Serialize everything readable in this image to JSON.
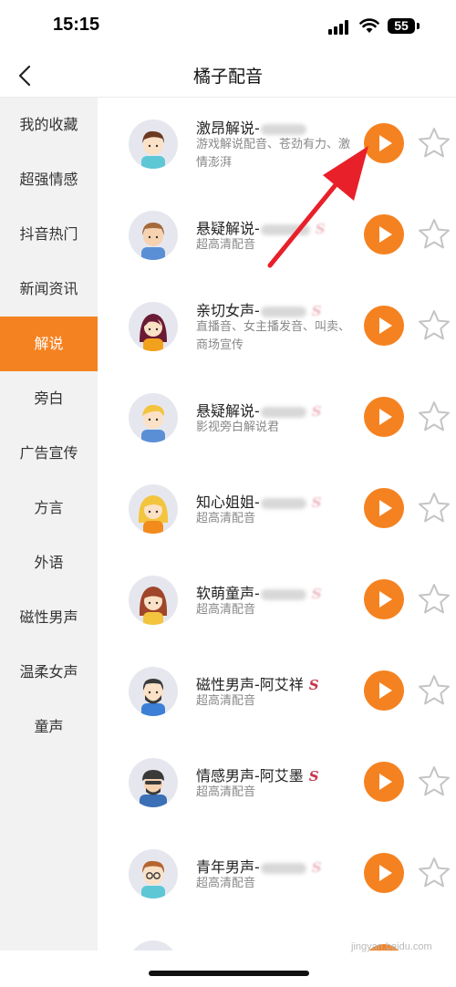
{
  "status_bar": {
    "time": "15:15",
    "battery": "55"
  },
  "nav": {
    "title": "橘子配音"
  },
  "sidebar": {
    "items": [
      {
        "label": "我的收藏"
      },
      {
        "label": "超强情感"
      },
      {
        "label": "抖音热门"
      },
      {
        "label": "新闻资讯"
      },
      {
        "label": "解说",
        "active": true
      },
      {
        "label": "旁白"
      },
      {
        "label": "广告宣传"
      },
      {
        "label": "方言"
      },
      {
        "label": "外语"
      },
      {
        "label": "磁性男声"
      },
      {
        "label": "温柔女声"
      },
      {
        "label": "童声"
      }
    ]
  },
  "voices": [
    {
      "title": "激昂解说-",
      "subtitle": "游戏解说配音、苍劲有力、激情澎湃"
    },
    {
      "title": "悬疑解说-",
      "subtitle": "超高清配音"
    },
    {
      "title": "亲切女声-",
      "subtitle": "直播音、女主播发音、叫卖、商场宣传"
    },
    {
      "title": "悬疑解说-",
      "subtitle": "影视旁白解说君"
    },
    {
      "title": "知心姐姐-",
      "subtitle": "超高清配音"
    },
    {
      "title": "软萌童声-",
      "subtitle": "超高清配音"
    },
    {
      "title": "磁性男声-阿艾祥",
      "subtitle": "超高清配音",
      "badge": "S"
    },
    {
      "title": "情感男声-阿艾墨",
      "subtitle": "超高清配音",
      "badge": "S"
    },
    {
      "title": "青年男声-",
      "subtitle": "超高清配音"
    }
  ],
  "watermark": "jingyan.baidu.com",
  "colors": {
    "accent": "#f58220",
    "sidebar_bg": "#f2f2f2",
    "badge": "#c8364b",
    "arrow": "#e8202a"
  }
}
